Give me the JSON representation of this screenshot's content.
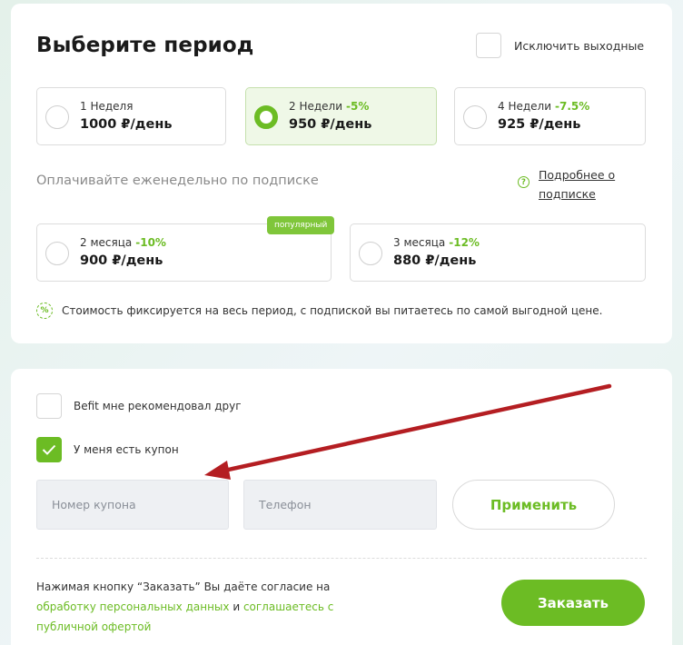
{
  "period": {
    "title": "Выберите период",
    "exclude_weekends": "Исключить выходные",
    "options": [
      {
        "name": "1 Неделя",
        "discount": "",
        "price": "1000 ₽/день",
        "selected": false
      },
      {
        "name": "2 Недели",
        "discount": "-5%",
        "price": "950 ₽/день",
        "selected": true
      },
      {
        "name": "4 Недели",
        "discount": "-7.5%",
        "price": "925 ₽/день",
        "selected": false
      }
    ],
    "subscription_heading": "Оплачивайте еженедельно по подписке",
    "subscription_more_line1": "Подробнее о",
    "subscription_more_line2": "подписке",
    "popular_badge": "популярный",
    "subscription_options": [
      {
        "name": "2 месяца",
        "discount": "-10%",
        "price": "900 ₽/день",
        "selected": false
      },
      {
        "name": "3 месяца",
        "discount": "-12%",
        "price": "880 ₽/день",
        "selected": false
      }
    ],
    "fixed_price_note": "Стоимость фиксируется на весь период, с подпиской вы питаетесь по самой выгодной цене."
  },
  "order": {
    "friend_recommended": "Befit мне рекомендовал друг",
    "friend_recommended_checked": false,
    "have_coupon": "У меня есть купон",
    "have_coupon_checked": true,
    "coupon_placeholder": "Номер купона",
    "phone_placeholder": "Телефон",
    "apply_label": "Применить",
    "consent_text_1": "Нажимая кнопку “Заказать” Вы даёте согласие на",
    "consent_link_1": "обработку персональных данных",
    "consent_and": " и ",
    "consent_link_2": "соглашаетесь с публичной офертой",
    "submit_label": "Заказать"
  },
  "colors": {
    "accent": "#6cbc24",
    "annotation_arrow": "#b41e22"
  }
}
